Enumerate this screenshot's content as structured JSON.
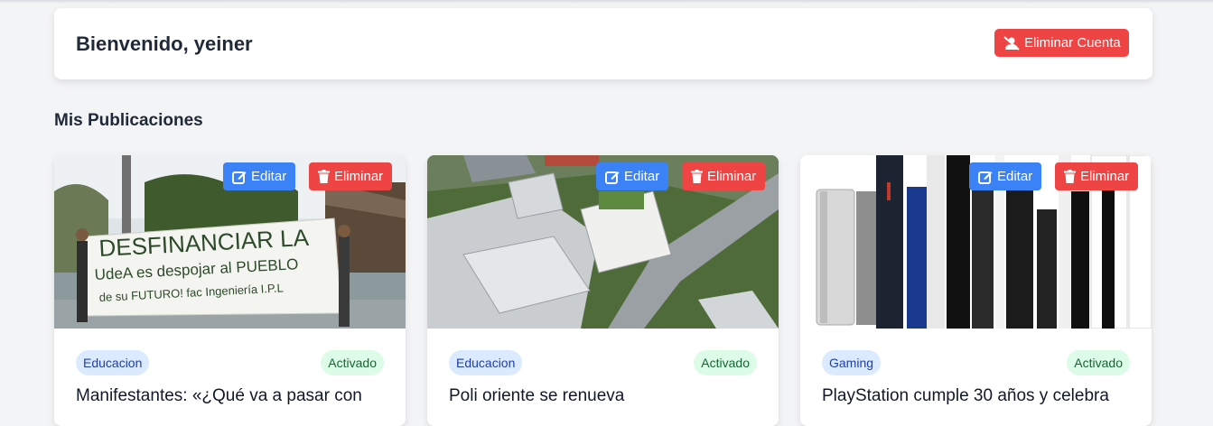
{
  "header": {
    "welcome": "Bienvenido, yeiner",
    "delete_account_label": "Eliminar Cuenta"
  },
  "section": {
    "title": "Mis Publicaciones"
  },
  "actions": {
    "edit_label": "Editar",
    "delete_label": "Eliminar"
  },
  "posts": [
    {
      "category": "Educacion",
      "status": "Activado",
      "title": "Manifestantes: «¿Qué va a pasar con",
      "banner_text": [
        "DESFINANCIAR LA",
        "UdeA es despojar al PUEBLO",
        "de su FUTURO! fac Ingeniería I.P.L"
      ]
    },
    {
      "category": "Educacion",
      "status": "Activado",
      "title": "Poli oriente se renueva"
    },
    {
      "category": "Gaming",
      "status": "Activado",
      "title": "PlayStation cumple 30 años y celebra"
    }
  ],
  "colors": {
    "danger": "#ef4444",
    "primary": "#3b82f6",
    "category_bg": "#dbeafe",
    "status_bg": "#dcfce7"
  }
}
